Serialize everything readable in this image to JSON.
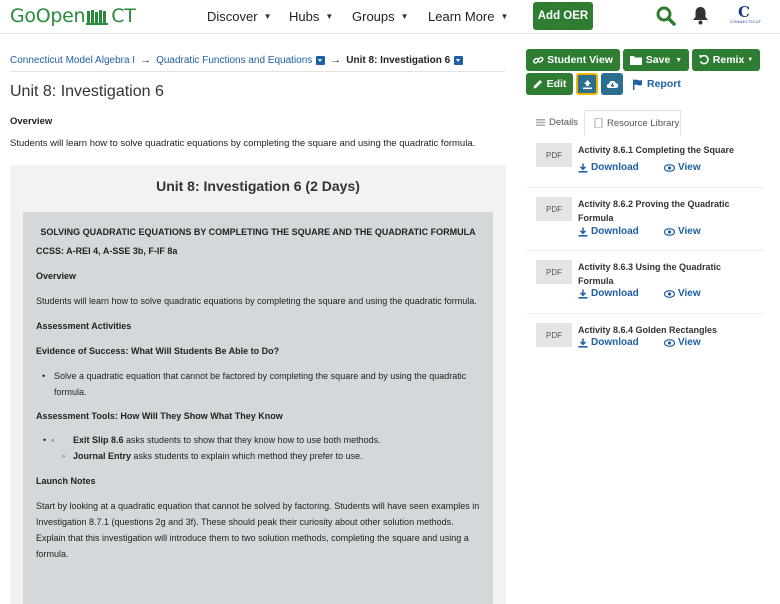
{
  "header": {
    "logo_left": "GoOpen",
    "logo_right": "CT",
    "nav": [
      "Discover",
      "Hubs",
      "Groups",
      "Learn More"
    ],
    "add_oer": "Add OER",
    "ct_logo": "C",
    "ct_logo_caption": "CONNECTICUT",
    "colors": {
      "brand": "#2b8a3e",
      "button": "#2e7d32",
      "link": "#1f5fa3"
    }
  },
  "breadcrumb": {
    "items": [
      "Connecticut Model Algebra I",
      "Quadratic Functions and Equations"
    ],
    "current": "Unit 8: Investigation 6"
  },
  "page": {
    "title": "Unit 8: Investigation 6",
    "overview_heading": "Overview",
    "overview_text": "Students will learn how to solve quadratic equations by completing the square and using the quadratic formula."
  },
  "content": {
    "title": "Unit 8: Investigation 6 (2 Days)",
    "heading": "SOLVING QUADRATIC EQUATIONS BY COMPLETING THE SQUARE AND THE QUADRATIC FORMULA",
    "ccss": "CCSS:  A-REI 4, A-SSE 3b, F-IF 8a",
    "overview_h": "Overview",
    "overview": "Students will learn how to solve quadratic equations by completing the square and using the quadratic formula.",
    "assessment_h": "Assessment Activities",
    "evidence_h": "Evidence of Success:  What Will Students Be Able to Do?",
    "evidence_item": "Solve a quadratic equation that cannot be factored by completing the square and by using the quadratic formula.",
    "tools_h": "Assessment Tools:  How Will They Show What They Know",
    "tools": [
      {
        "bold": "Exit Slip 8.6",
        "text": " asks students to show that they know how to use both methods."
      },
      {
        "bold": "Journal Entry",
        "text": " asks students to explain which method they prefer to use."
      }
    ],
    "launch_h": "Launch Notes",
    "launch": "Start by looking at a quadratic equation that cannot be solved by factoring.  Students will have seen examples in Investigation 8.7.1 (questions 2g and 3f).  These should peak their curiosity about other solution methods.  Explain that this investigation will introduce them to two solution methods, completing the square and using a formula."
  },
  "actions": {
    "student_view": "Student View",
    "save": "Save",
    "remix": "Remix",
    "edit": "Edit",
    "report": "Report"
  },
  "tabs": {
    "details": "Details",
    "library": "Resource Library"
  },
  "resources": [
    {
      "type": "PDF",
      "title": "Activity 8.6.1 Completing the Square",
      "download": "Download",
      "view": "View"
    },
    {
      "type": "PDF",
      "title": "Activity 8.6.2 Proving the Quadratic Formula",
      "download": "Download",
      "view": "View"
    },
    {
      "type": "PDF",
      "title": "Activity 8.6.3 Using the Quadratic Formula",
      "download": "Download",
      "view": "View"
    },
    {
      "type": "PDF",
      "title": "Activity 8.6.4 Golden Rectangles",
      "download": "Download",
      "view": "View"
    }
  ]
}
